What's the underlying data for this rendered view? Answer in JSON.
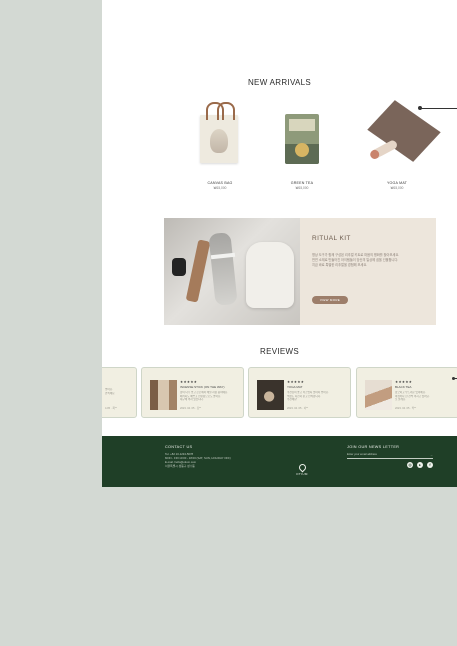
{
  "new_arrivals": {
    "title": "NEW ARRIVALS",
    "products": [
      {
        "name": "CANVAS BAG",
        "price": "₩15,000"
      },
      {
        "name": "GREEN TEA",
        "price": "₩15,000"
      },
      {
        "name": "YOGA MAT",
        "price": "₩15,000"
      }
    ]
  },
  "ritual_kit": {
    "title": "RITUAL KIT",
    "description": [
      "명상 도구가 함께 구성된 리추얼 키트로 마음의 평화를 찾아보세요.",
      "천연 소재로 만들어진 아이템들이 당신의 일상에 쉼을 선물합니다.",
      "지금 바로 특별한 리추얼을 경험해 보세요."
    ],
    "button": "VIEW MORE"
  },
  "reviews": {
    "title": "REVIEWS",
    "items": [
      {
        "stars": "★★★★★",
        "name": "INCENSE STICK (ON THE WAY)",
        "text": [
          "향이 너무 좋고 은은해서 매일 사용 중이에요.",
          "패키지도 예쁘고 선물용으로도 좋아요.",
          "재구매 의사 있습니다."
        ],
        "date": "2023. 04. 05 · 김**"
      },
      {
        "stars": "★★★★★",
        "name": "YOGA MAT",
        "text": [
          "쿠션감이 좋고 미끄럽지 않아서 좋아요.",
          "색상도 사진과 같고 만족합니다.",
          "추천해요!"
        ],
        "date": "2023. 04. 05 · 이**"
      },
      {
        "stars": "★★★★★",
        "name": "BLACK TEA",
        "text": [
          "향긋하고 부드러운 맛이에요.",
          "아침마다 한 잔씩 마시고 있어요.",
          "또 살게요."
        ],
        "date": "2023. 04. 05 · 박**"
      }
    ],
    "partial_left": {
      "text": [
        "좋아요.",
        "만족해요."
      ],
      "date": "4.05 · 최**"
    }
  },
  "footer": {
    "contact_title": "CONTACT US",
    "contact_lines": [
      "Tel. +82 10-1234-5678",
      "MON - FRI 10:00 - 18:00 (SAT, SUN, HOLIDAY OFF)",
      "E-mail. hello@otium.com",
      "서울특별시 성동구 성수동"
    ],
    "newsletter_title": "JOIN OUR NEWS LETTER",
    "email_placeholder": "Enter your email address",
    "email_arrow": "→",
    "brand": "OTIUM",
    "social_icons": [
      "instagram-icon",
      "youtube-icon",
      "facebook-icon"
    ]
  },
  "colors": {
    "background": "#d3d9d3",
    "footer": "#1f3f27",
    "kit_panel": "#ede6dc",
    "review_card": "#f1efe2",
    "button": "#9d7e6a"
  }
}
